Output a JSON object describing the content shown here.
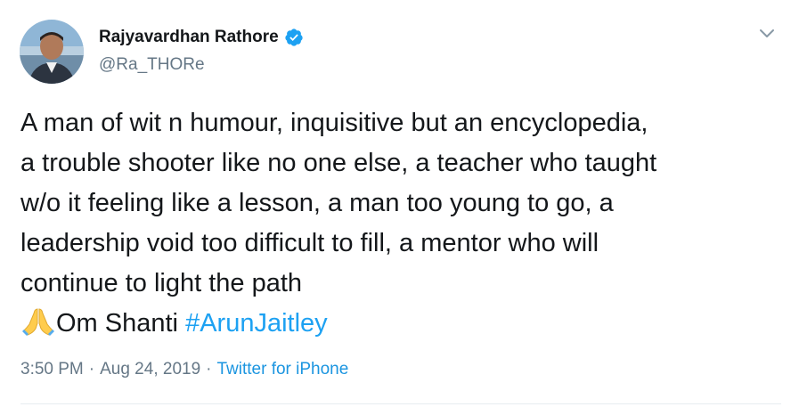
{
  "author": {
    "name": "Rajyavardhan Rathore",
    "handle": "@Ra_THORe",
    "verified": true
  },
  "tweet": {
    "line1": "A man of wit n humour, inquisitive but an encyclopedia,",
    "line2": "a trouble shooter like no one else, a teacher who taught",
    "line3": "w/o it feeling like a lesson, a man too young to go, a",
    "line4": "leadership void too difficult to fill, a mentor who will",
    "line5": "continue to light the path",
    "closing_text": "Om Shanti ",
    "hashtag": "#ArunJaitley",
    "emoji": "folded-hands-icon"
  },
  "meta": {
    "time": "3:50 PM",
    "separator": "·",
    "date": "Aug 24, 2019",
    "source": "Twitter for iPhone"
  },
  "colors": {
    "accent": "#1da1f2",
    "link": "#1b95e0",
    "muted": "#657786",
    "text": "#14171a",
    "divider": "#e6ecf0"
  }
}
